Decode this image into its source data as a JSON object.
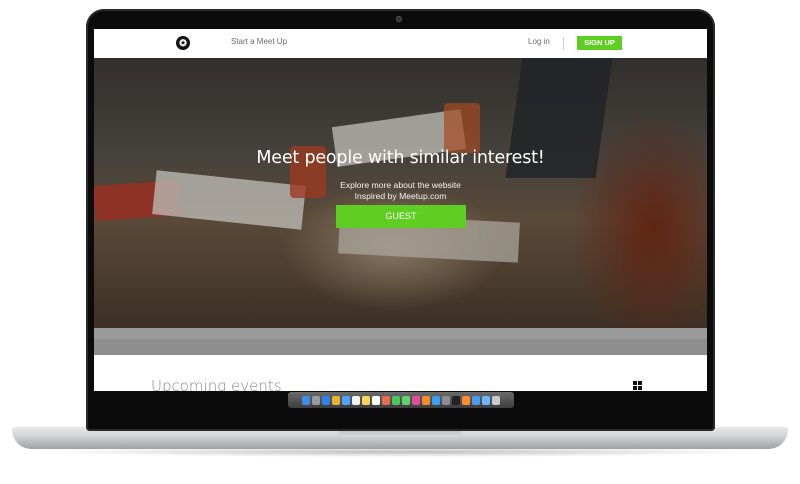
{
  "nav": {
    "start_meetup": "Start a Meet Up",
    "login": "Log in",
    "signup": "SIGN UP",
    "logo_icon": "meetup-logo-icon"
  },
  "hero": {
    "title": "Meet people with similar interest!",
    "subtitle_line1": "Explore more about the website",
    "subtitle_line2": "Inspired by Meetup.com",
    "guest_button": "GUEST"
  },
  "section": {
    "upcoming_title": "Upcoming events",
    "view_icon": "grid-view-icon"
  },
  "colors": {
    "accent_green": "#5fce22",
    "text_gray": "#6c6c6c"
  },
  "dock": {
    "icons": [
      "finder-icon",
      "launchpad-icon",
      "safari-icon",
      "chrome-icon",
      "mail-icon",
      "calendar-icon",
      "notes-icon",
      "reminders-icon",
      "photos-icon",
      "messages-icon",
      "facetime-icon",
      "itunes-icon",
      "ibooks-icon",
      "appstore-icon",
      "settings-icon",
      "terminal-icon",
      "sublime-icon",
      "downloads-icon",
      "folder-icon",
      "trash-icon"
    ]
  }
}
